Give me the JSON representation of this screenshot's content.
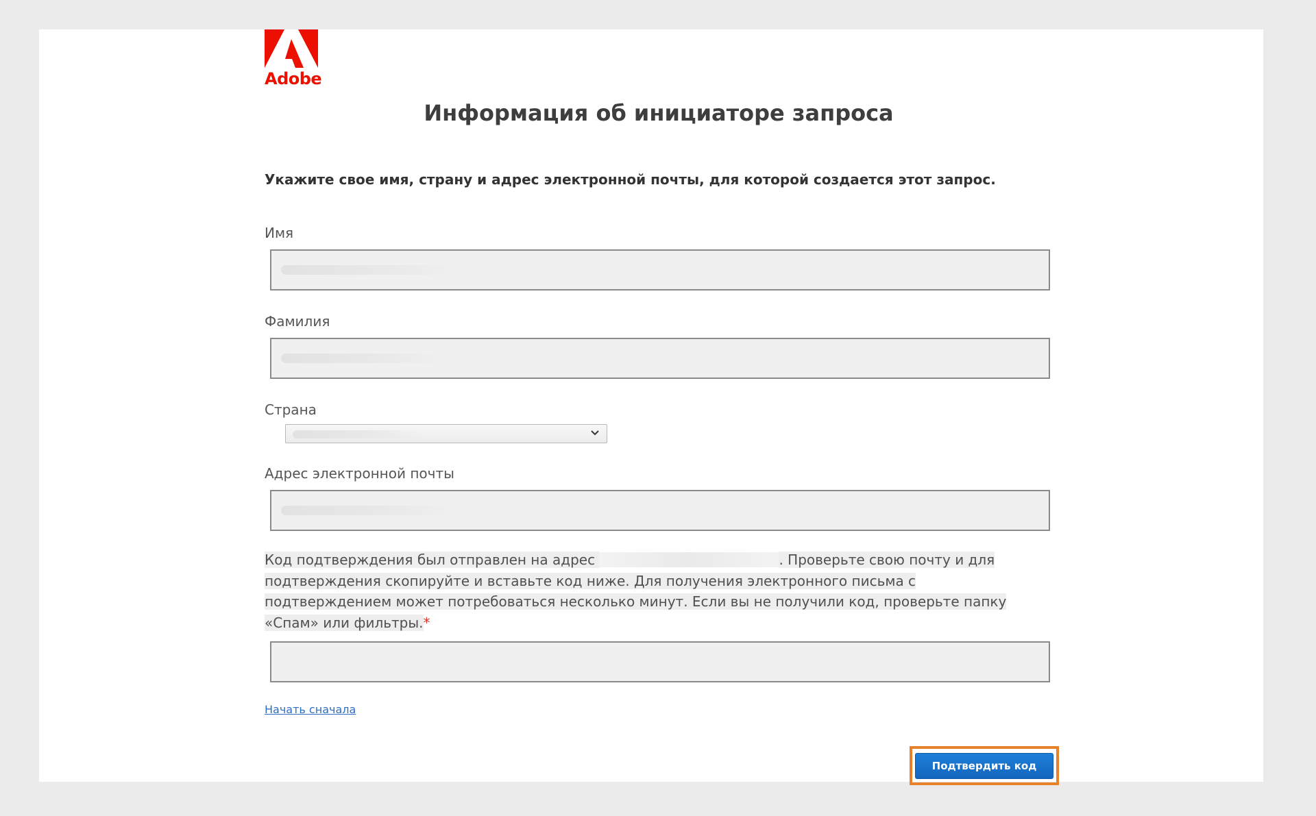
{
  "brand": {
    "logo_word": "Adobe",
    "icon": "adobe-logo-icon",
    "color": "#eb1000"
  },
  "form": {
    "title": "Информация об инициаторе запроса",
    "intro": "Укажите свое имя, страну и адрес электронной почты, для которой создается этот запрос.",
    "first_name": {
      "label": "Имя",
      "value": ""
    },
    "last_name": {
      "label": "Фамилия",
      "value": ""
    },
    "country": {
      "label": "Страна",
      "selected": "",
      "icon": "chevron-down-icon"
    },
    "email": {
      "label": "Адрес электронной почты",
      "value": ""
    },
    "verification": {
      "text_before": "Код подтверждения был отправлен на адрес ",
      "text_after": ". Проверьте свою почту и для подтверждения скопируйте и вставьте код ниже. Для получения электронного письма с подтверждением может потребоваться несколько минут. Если вы не получили код, проверьте папку «Спам» или фильтры.",
      "required_mark": "*",
      "code_value": ""
    },
    "restart_link": "Начать сначала",
    "submit_label": "Подтвердить код"
  },
  "colors": {
    "link": "#2d6fc4",
    "button": "#1473e6",
    "focus_ring": "#e8822a",
    "required": "#e0342d"
  }
}
